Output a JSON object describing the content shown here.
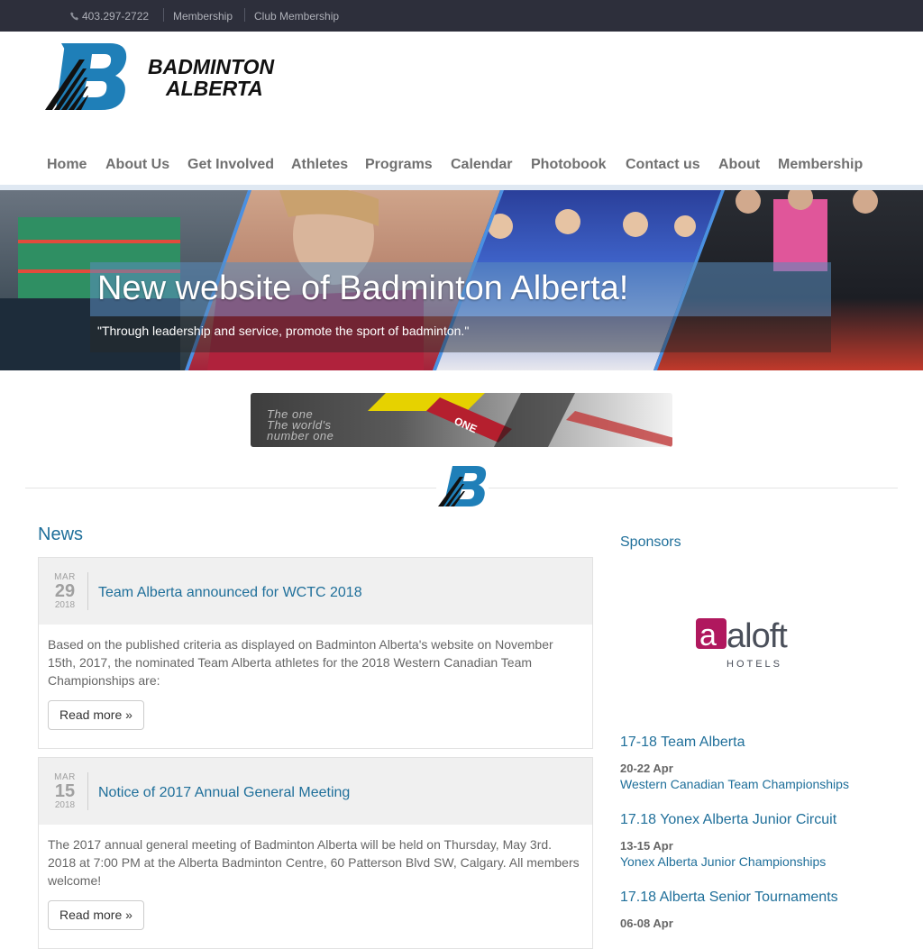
{
  "topbar": {
    "phone": "403.297-2722",
    "links": [
      "Membership",
      "Club Membership"
    ]
  },
  "logo": {
    "line1": "BADMINTON",
    "line2": "ALBERTA",
    "mark": "B"
  },
  "nav": [
    "Home",
    "About Us",
    "Get Involved",
    "Athletes",
    "Programs",
    "Calendar",
    "Photobook",
    "Contact us",
    "About",
    "Membership"
  ],
  "hero": {
    "title": "New website of Badminton Alberta!",
    "quote": "\"Through leadership and service, promote the sport of badminton.\""
  },
  "ad": {
    "line1": "The one",
    "line2": "The world's",
    "line3": "number one",
    "brand": "ONE"
  },
  "news": {
    "heading": "News",
    "posts": [
      {
        "month": "MAR",
        "day": "29",
        "year": "2018",
        "title": "Team Alberta announced for WCTC 2018",
        "body": "Based on the published criteria as displayed on Badminton Alberta's website on November 15th, 2017, the nominated Team Alberta athletes for the 2018 Western Canadian Team Championships are:",
        "read_more": "Read more »"
      },
      {
        "month": "MAR",
        "day": "15",
        "year": "2018",
        "title": "Notice of 2017 Annual General Meeting",
        "body": "The 2017 annual general meeting of Badminton Alberta will be held on Thursday, May 3rd. 2018 at 7:00 PM at the Alberta Badminton Centre, 60 Patterson Blvd SW, Calgary. All members welcome!",
        "read_more": "Read more »"
      }
    ]
  },
  "sidebar": {
    "sponsors_heading": "Sponsors",
    "sponsor": {
      "name": "aloft",
      "sub": "HOTELS"
    },
    "sections": [
      {
        "title": "17-18 Team Alberta",
        "date": "20-22 Apr",
        "event": "Western Canadian Team Championships"
      },
      {
        "title": "17.18 Yonex Alberta Junior Circuit",
        "date": "13-15 Apr",
        "event": "Yonex Alberta Junior Championships"
      },
      {
        "title": "17.18 Alberta Senior Tournaments",
        "date": "06-08 Apr",
        "event": ""
      }
    ]
  },
  "colors": {
    "link": "#1f6f9a",
    "topbar": "#2d2f3b",
    "brand_blue": "#1f7fb8",
    "aloft": "#b0185e"
  }
}
